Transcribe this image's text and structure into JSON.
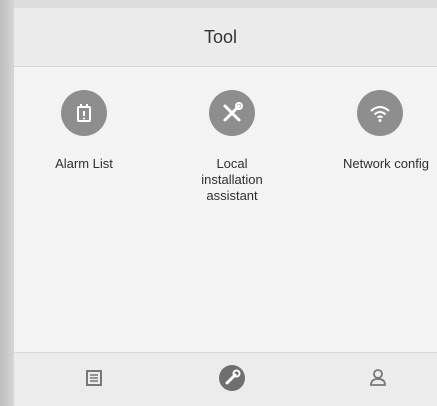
{
  "header": {
    "title": "Tool"
  },
  "tools": [
    {
      "label": "Alarm List",
      "icon": "alarm-list-icon"
    },
    {
      "label": "Local\ninstallation\nassistant",
      "icon": "wrench-screwdriver-icon"
    },
    {
      "label": "Network config",
      "icon": "wifi-icon"
    }
  ],
  "tabbar": [
    {
      "icon": "list-icon"
    },
    {
      "icon": "wrench-icon",
      "active": true
    },
    {
      "icon": "user-icon"
    }
  ],
  "colors": {
    "icon_bg": "#8e8e8e",
    "header_bg": "#ebebeb",
    "background": "#f3f3f3"
  }
}
